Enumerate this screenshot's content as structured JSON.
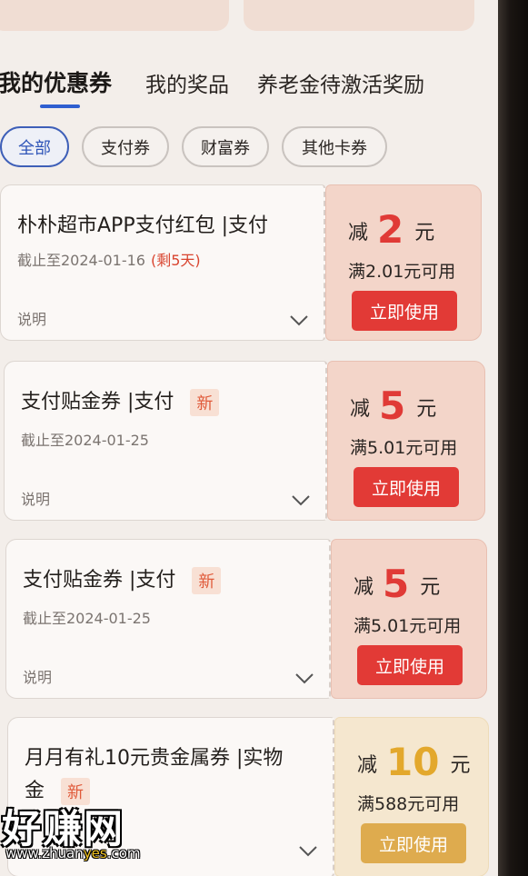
{
  "tabs": {
    "items": [
      {
        "label": "我的优惠券",
        "active": true
      },
      {
        "label": "我的奖品",
        "active": false
      },
      {
        "label": "养老金待激活奖励",
        "active": false
      }
    ]
  },
  "filters": {
    "chips": [
      {
        "label": "全部",
        "active": true
      },
      {
        "label": "支付券",
        "active": false
      },
      {
        "label": "财富券",
        "active": false
      },
      {
        "label": "其他卡券",
        "active": false
      }
    ]
  },
  "coupons": [
    {
      "title": "朴朴超市APP支付红包 |支付",
      "badge": "",
      "deadline": "截止至2024-01-16",
      "remaining": "(剩5天)",
      "note": "说明",
      "amount_label": "减",
      "amount": "2",
      "unit": "元",
      "condition": "满2.01元可用",
      "button": "立即使用",
      "theme": "red"
    },
    {
      "title": "支付贴金券 |支付",
      "badge": "新",
      "deadline": "截止至2024-01-25",
      "remaining": "",
      "note": "说明",
      "amount_label": "减",
      "amount": "5",
      "unit": "元",
      "condition": "满5.01元可用",
      "button": "立即使用",
      "theme": "red"
    },
    {
      "title": "支付贴金券 |支付",
      "badge": "新",
      "deadline": "截止至2024-01-25",
      "remaining": "",
      "note": "说明",
      "amount_label": "减",
      "amount": "5",
      "unit": "元",
      "condition": "满5.01元可用",
      "button": "立即使用",
      "theme": "red"
    },
    {
      "title": "月月有礼10元贵金属券 |实物",
      "title_line2": "金",
      "badge": "新",
      "deadline": "",
      "remaining": "",
      "note": "",
      "amount_label": "减",
      "amount": "10",
      "unit": "元",
      "condition": "满588元可用",
      "button": "立即使用",
      "theme": "gold"
    }
  ],
  "watermark": {
    "logo": "好赚网",
    "url_pre": "www.zhuan",
    "url_hl": "yes",
    "url_post": ".com"
  },
  "colors": {
    "accent_blue": "#2f5fd0",
    "coupon_red": "#e23a36",
    "coupon_gold": "#deab4e"
  }
}
